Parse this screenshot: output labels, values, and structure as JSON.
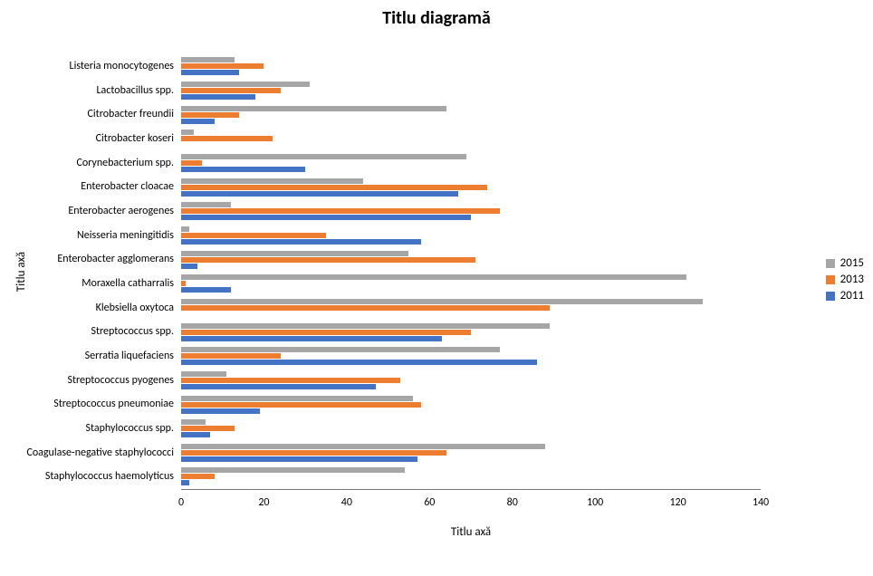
{
  "chart_data": {
    "type": "bar",
    "orientation": "horizontal",
    "title": "Titlu diagramă",
    "xlabel": "Titlu axă",
    "ylabel": "Titlu axă",
    "xlim": [
      0,
      140
    ],
    "xticks": [
      0,
      20,
      40,
      60,
      80,
      100,
      120,
      140
    ],
    "categories": [
      "Listeria monocytogenes",
      "Lactobacillus spp.",
      "Citrobacter freundii",
      "Citrobacter koseri",
      "Corynebacterium spp.",
      "Enterobacter cloacae",
      "Enterobacter aerogenes",
      "Neisseria meningitidis",
      "Enterobacter agglomerans",
      "Moraxella catharralis",
      "Klebsiella oxytoca",
      "Streptococcus spp.",
      "Serratia liquefaciens",
      "Streptococcus pyogenes",
      "Streptococcus pneumoniae",
      "Staphylococcus spp.",
      "Coagulase-negative staphylococci",
      "Staphylococcus haemolyticus"
    ],
    "series": [
      {
        "name": "2015",
        "color": "#a6a6a6",
        "values": [
          13,
          31,
          64,
          3,
          69,
          44,
          12,
          2,
          55,
          122,
          126,
          89,
          77,
          11,
          56,
          6,
          88,
          54
        ]
      },
      {
        "name": "2013",
        "color": "#ed7d31",
        "values": [
          20,
          24,
          14,
          22,
          5,
          74,
          77,
          35,
          71,
          1,
          89,
          70,
          24,
          53,
          58,
          13,
          64,
          8
        ]
      },
      {
        "name": "2011",
        "color": "#4472c4",
        "values": [
          14,
          18,
          8,
          0,
          30,
          67,
          70,
          58,
          4,
          12,
          0,
          63,
          86,
          47,
          19,
          7,
          57,
          2
        ]
      }
    ],
    "legend_position": "right"
  }
}
